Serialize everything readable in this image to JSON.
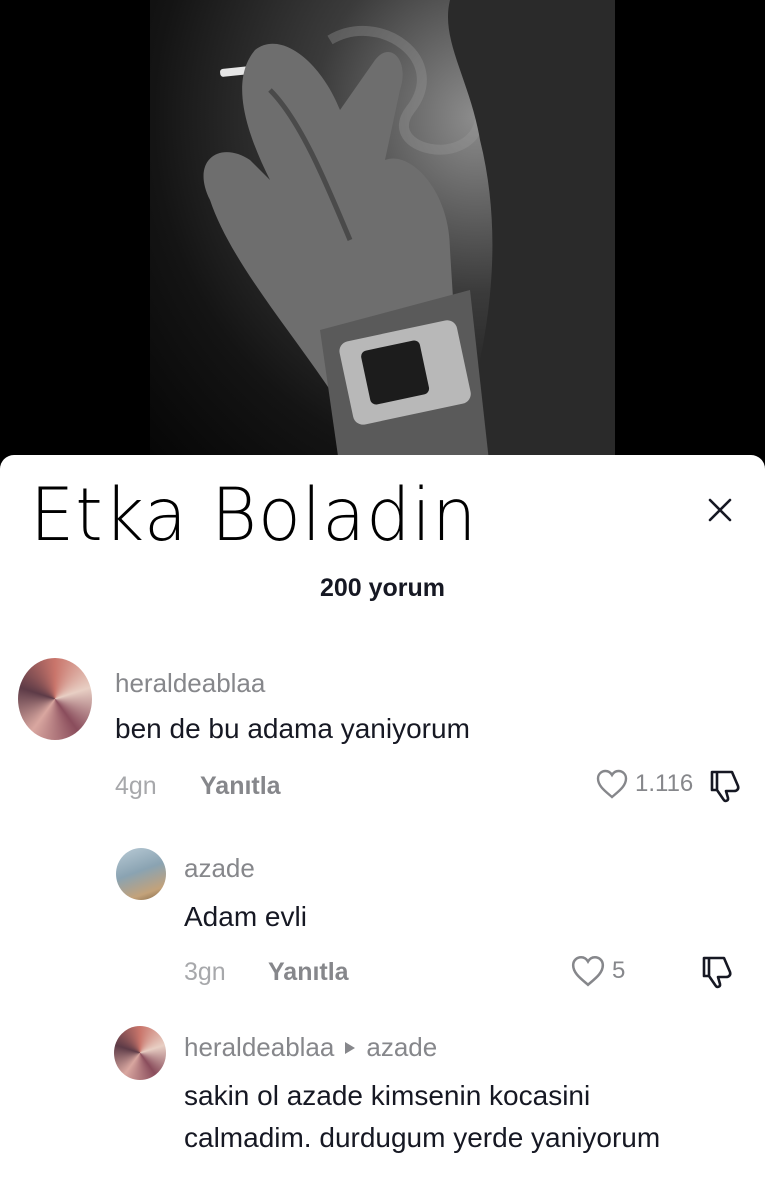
{
  "header": {
    "title": "Etka Boladin",
    "comment_count": "200 yorum"
  },
  "icons": {
    "close": "close-icon",
    "like": "heart-outline-icon",
    "dislike": "thumbs-down-icon",
    "reply_arrow": "triangle-right-icon"
  },
  "comments": [
    {
      "username": "heraldeablaa",
      "text": "ben de bu adama yaniyorum",
      "time": "4gn",
      "reply_label": "Yanıtla",
      "likes": "1.116"
    },
    {
      "username": "azade",
      "text": "Adam evli",
      "time": "3gn",
      "reply_label": "Yanıtla",
      "likes": "5"
    },
    {
      "username": "heraldeablaa",
      "reply_to": "azade",
      "text": "sakin ol azade kimsenin kocasini calmadim. durdugum yerde yaniyorum"
    }
  ]
}
